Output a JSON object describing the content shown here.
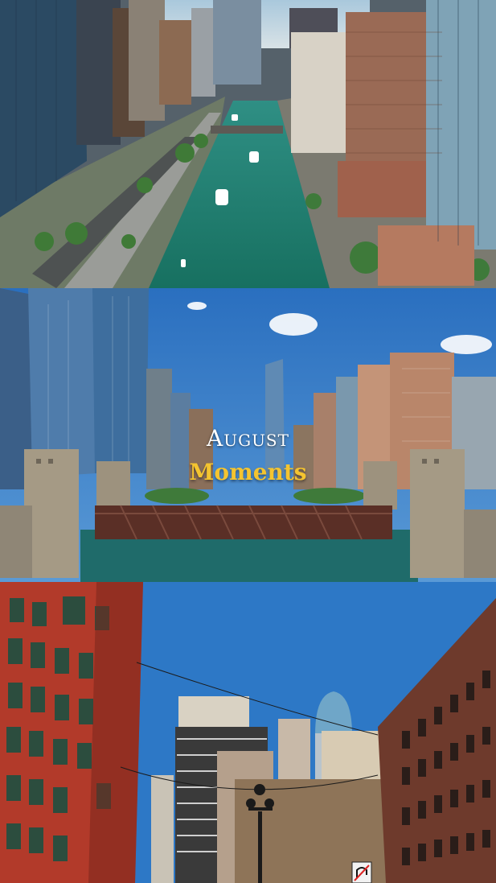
{
  "overlay": {
    "line1": "August",
    "line2": "Moments"
  },
  "scenes": {
    "top": "aerial-river-canyon",
    "middle": "river-bridge-towers",
    "bottom": "street-upward-buildings"
  },
  "colors": {
    "sky": "#2d78c6",
    "river": "#1f7a70",
    "title_white": "#ffffff",
    "title_gold": "#f4c430",
    "brick": "#b23a2a"
  },
  "sign": {
    "symbol": "no-u-turn"
  }
}
